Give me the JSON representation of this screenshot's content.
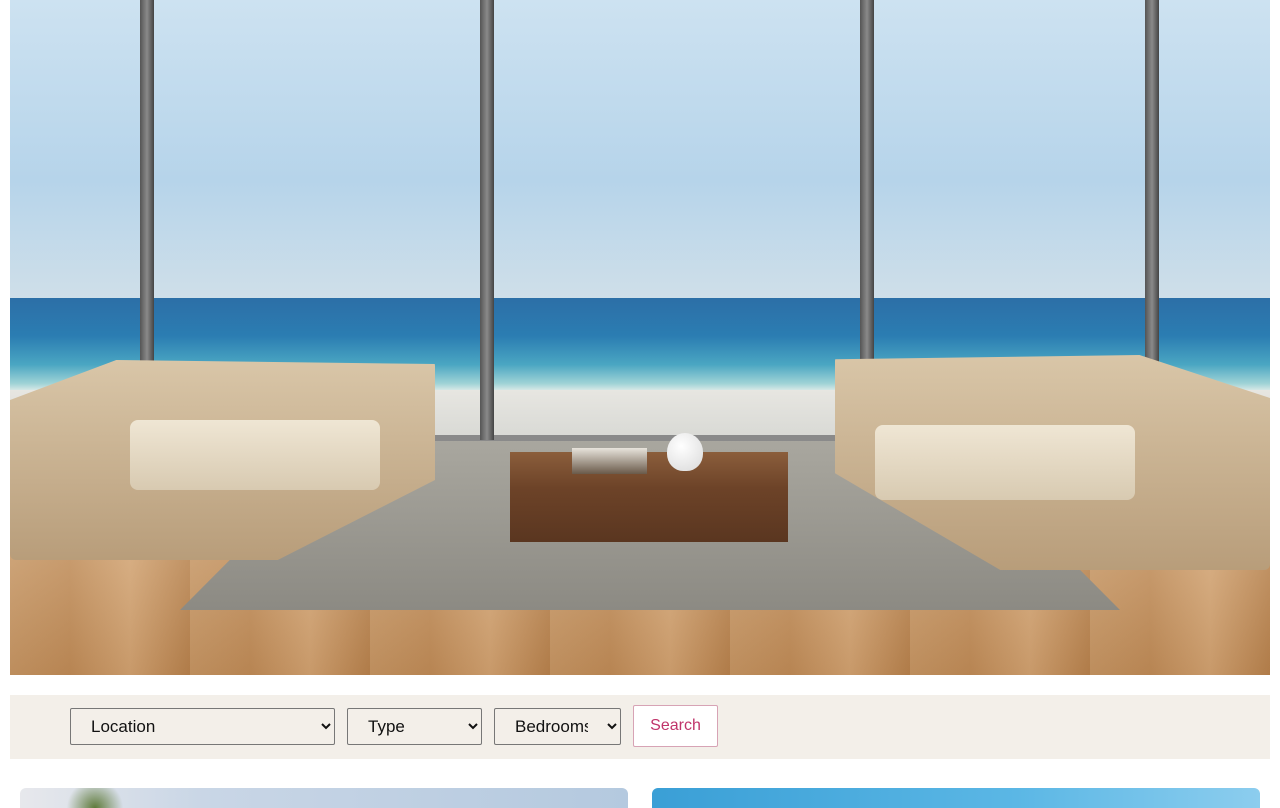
{
  "hero": {
    "image_alt": "Modern beachfront living room with floor-to-ceiling windows overlooking the ocean"
  },
  "search": {
    "location_label": "Location",
    "type_label": "Type",
    "bedrooms_label": "Bedrooms",
    "button_label": "Search"
  },
  "colors": {
    "search_bar_bg": "#f3efe9",
    "button_text": "#c0336a",
    "button_border": "#d7a3b5"
  }
}
